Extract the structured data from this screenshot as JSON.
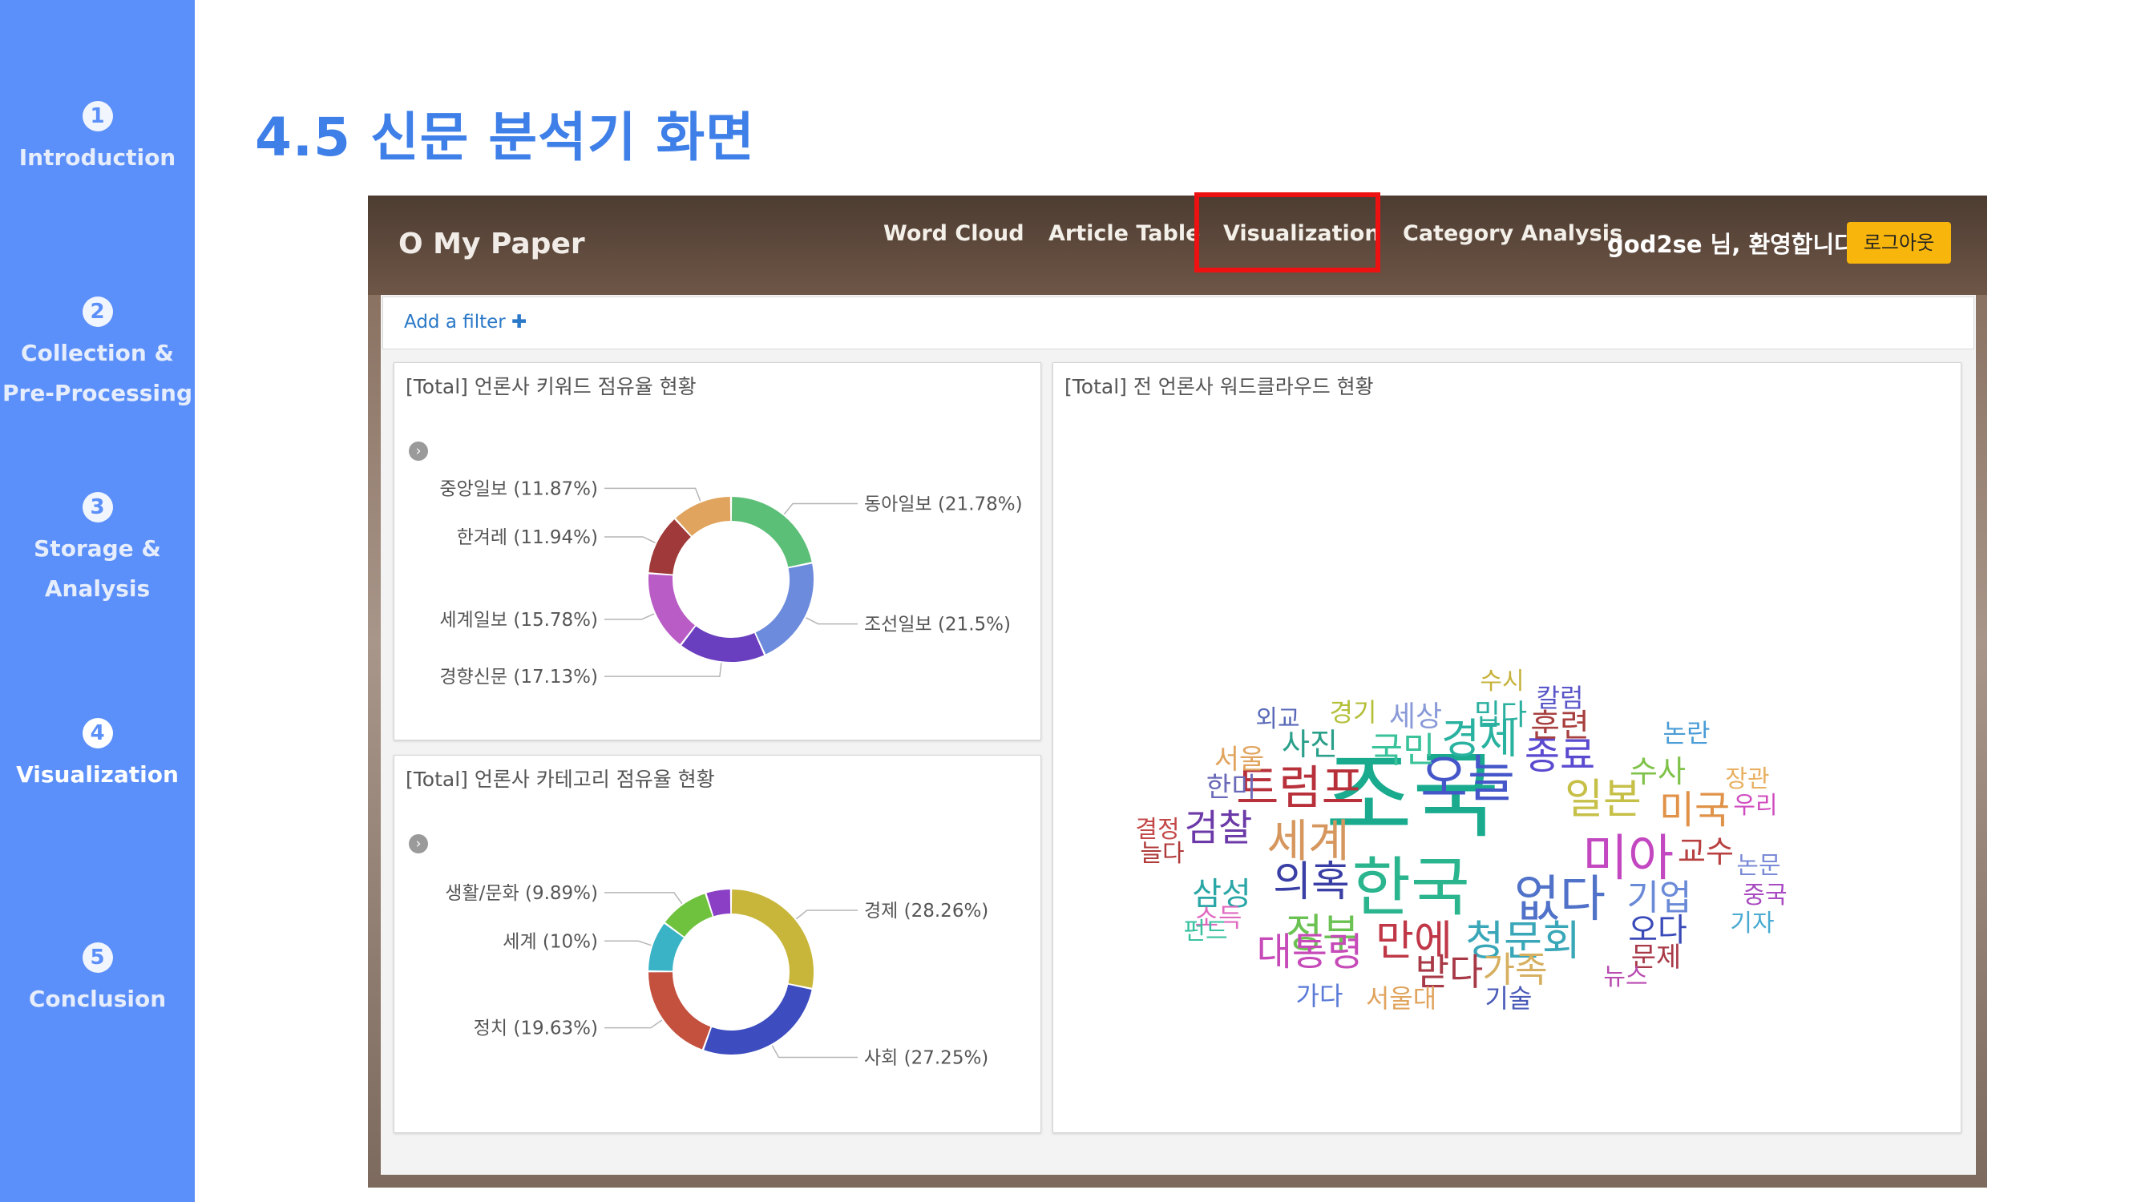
{
  "slide": {
    "title": "4.5 신문 분석기 화면",
    "sections": [
      {
        "num": "1",
        "lines": [
          "Introduction"
        ]
      },
      {
        "num": "2",
        "lines": [
          "Collection &",
          "Pre-Processing"
        ]
      },
      {
        "num": "3",
        "lines": [
          "Storage &",
          "Analysis"
        ]
      },
      {
        "num": "4",
        "lines": [
          "Visualization"
        ],
        "active": true
      },
      {
        "num": "5",
        "lines": [
          "Conclusion"
        ]
      }
    ]
  },
  "app": {
    "brand": "O My Paper",
    "nav": [
      "Word Cloud",
      "Article Table",
      "Visualization",
      "Category Analysis"
    ],
    "welcome": "god2se 님, 환영합니다.",
    "logout": "로그아웃",
    "add_filter": "Add a filter ✚",
    "panels": {
      "keyword": "[Total] 언론사 키워드 점유율 현황",
      "category": "[Total] 언론사 카테고리 점유율 현황",
      "cloud": "[Total] 전 언론사 워드클라우드 현황"
    }
  },
  "chart_data": [
    {
      "type": "pie",
      "title": "[Total] 언론사 키워드 점유율 현황",
      "slices": [
        {
          "label": "동아일보",
          "value": 21.78,
          "display": "동아일보 (21.78%)",
          "color": "#5cbf77"
        },
        {
          "label": "조선일보",
          "value": 21.5,
          "display": "조선일보 (21.5%)",
          "color": "#6d8bdc"
        },
        {
          "label": "경향신문",
          "value": 17.13,
          "display": "경향신문 (17.13%)",
          "color": "#6a3fbf"
        },
        {
          "label": "세계일보",
          "value": 15.78,
          "display": "세계일보 (15.78%)",
          "color": "#b95cc6"
        },
        {
          "label": "한겨레",
          "value": 11.94,
          "display": "한겨레 (11.94%)",
          "color": "#a03a3a"
        },
        {
          "label": "중앙일보",
          "value": 11.87,
          "display": "중앙일보 (11.87%)",
          "color": "#e0a45e"
        }
      ]
    },
    {
      "type": "pie",
      "title": "[Total] 언론사 카테고리 점유율 현황",
      "slices": [
        {
          "label": "경제",
          "value": 28.26,
          "display": "경제 (28.26%)",
          "color": "#c8b63a"
        },
        {
          "label": "사회",
          "value": 27.25,
          "display": "사회 (27.25%)",
          "color": "#3d4dbf"
        },
        {
          "label": "정치",
          "value": 19.63,
          "display": "정치 (19.63%)",
          "color": "#c4503e"
        },
        {
          "label": "세계",
          "value": 10,
          "display": "세계 (10%)",
          "color": "#3ab3c7"
        },
        {
          "label": "생활/문화",
          "value": 9.89,
          "display": "생활/문화 (9.89%)",
          "color": "#6fc23e"
        },
        {
          "label": "(unlabeled)",
          "value": 4.97,
          "display": "",
          "color": "#8a3fc4"
        }
      ]
    }
  ],
  "wordcloud": [
    {
      "text": "조국",
      "color": "#1aab8f",
      "size": 118
    },
    {
      "text": "한국",
      "color": "#2bb58f",
      "size": 80
    },
    {
      "text": "오늘",
      "color": "#4456c8",
      "size": 64
    },
    {
      "text": "미아",
      "color": "#c247c0",
      "size": 62
    },
    {
      "text": "트럼프",
      "color": "#b7303a",
      "size": 58
    },
    {
      "text": "없다",
      "color": "#5072c8",
      "size": 62
    },
    {
      "text": "세계",
      "color": "#d6975e",
      "size": 56
    },
    {
      "text": "경제",
      "color": "#2ab2a0",
      "size": 52
    },
    {
      "text": "검찰",
      "color": "#6c3aa8",
      "size": 46
    },
    {
      "text": "의혹",
      "color": "#3a3fa6",
      "size": 52
    },
    {
      "text": "정부",
      "color": "#6bc253",
      "size": 50
    },
    {
      "text": "만에",
      "color": "#c03848",
      "size": 52
    },
    {
      "text": "청문회",
      "color": "#3aa7b8",
      "size": 52
    },
    {
      "text": "대통령",
      "color": "#c64ab8",
      "size": 48
    },
    {
      "text": "일본",
      "color": "#c6c048",
      "size": 52
    },
    {
      "text": "미국",
      "color": "#e09248",
      "size": 48
    },
    {
      "text": "종료",
      "color": "#5a4ad0",
      "size": 48
    },
    {
      "text": "훈련",
      "color": "#a84040",
      "size": 40
    },
    {
      "text": "국민",
      "color": "#3ac29a",
      "size": 44
    },
    {
      "text": "사진",
      "color": "#2a9f8a",
      "size": 38
    },
    {
      "text": "기업",
      "color": "#6a8ad8",
      "size": 44
    },
    {
      "text": "받다",
      "color": "#a83a48",
      "size": 46
    },
    {
      "text": "가족",
      "color": "#d6b060",
      "size": 44
    },
    {
      "text": "오다",
      "color": "#3a4ab8",
      "size": 40
    },
    {
      "text": "수사",
      "color": "#7fc24a",
      "size": 38
    },
    {
      "text": "삼성",
      "color": "#2aa6a6",
      "size": 40
    },
    {
      "text": "교수",
      "color": "#b84040",
      "size": 38
    },
    {
      "text": "밉다",
      "color": "#2bb0a0",
      "size": 36
    },
    {
      "text": "세상",
      "color": "#8a9ad8",
      "size": 36
    },
    {
      "text": "경기",
      "color": "#b4bf38",
      "size": 32
    },
    {
      "text": "칼럼",
      "color": "#5a56c8",
      "size": 32
    },
    {
      "text": "수시",
      "color": "#c6b23a",
      "size": 30
    },
    {
      "text": "외교",
      "color": "#5a6ab8",
      "size": 30
    },
    {
      "text": "논란",
      "color": "#4a9cd6",
      "size": 32
    },
    {
      "text": "서울",
      "color": "#e0a45e",
      "size": 34
    },
    {
      "text": "한미",
      "color": "#6a6ab8",
      "size": 34
    },
    {
      "text": "장관",
      "color": "#e8b060",
      "size": 30
    },
    {
      "text": "우리",
      "color": "#d04cc0",
      "size": 30
    },
    {
      "text": "결정",
      "color": "#c44848",
      "size": 30
    },
    {
      "text": "늘다",
      "color": "#b03a3a",
      "size": 30
    },
    {
      "text": "논문",
      "color": "#7a8ad6",
      "size": 30
    },
    {
      "text": "소득",
      "color": "#e06ac0",
      "size": 32
    },
    {
      "text": "중국",
      "color": "#a84ac0",
      "size": 30
    },
    {
      "text": "펀드",
      "color": "#3ac2a0",
      "size": 30
    },
    {
      "text": "문제",
      "color": "#a83a48",
      "size": 34
    },
    {
      "text": "기자",
      "color": "#4aaad0",
      "size": 30
    },
    {
      "text": "뉴스",
      "color": "#b84ab0",
      "size": 30
    },
    {
      "text": "가다",
      "color": "#5a7ad8",
      "size": 32
    },
    {
      "text": "서울대",
      "color": "#e0a45e",
      "size": 32
    },
    {
      "text": "기술",
      "color": "#4a5ab8",
      "size": 32
    }
  ]
}
